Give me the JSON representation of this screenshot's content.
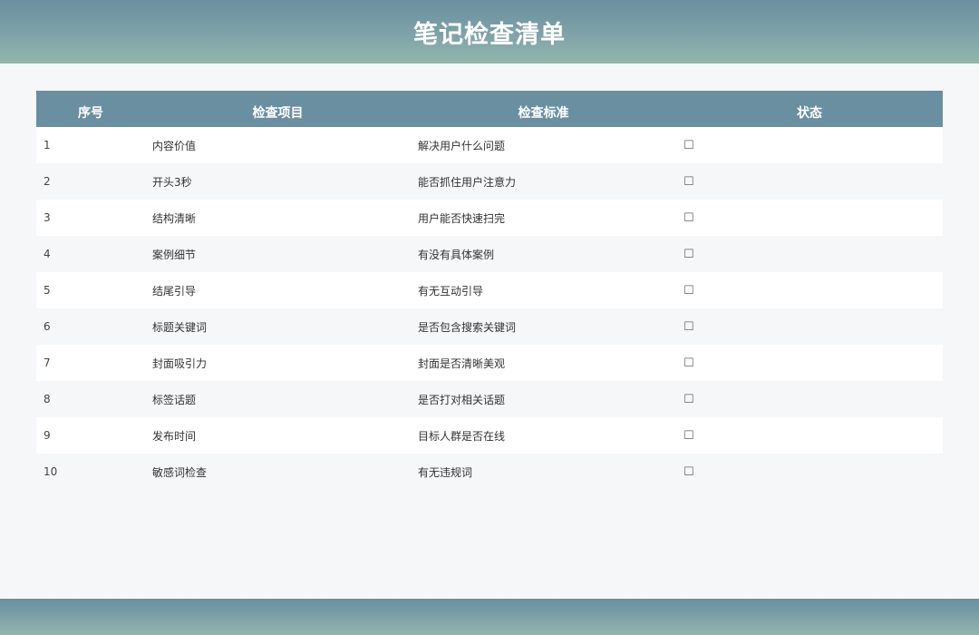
{
  "header": {
    "title": "笔记检查清单"
  },
  "colors": {
    "header_bar": "#6a8fa0",
    "header_gradient_end": "#93b7ad",
    "page_background": "#f5f7f9",
    "row_alt": "#f5f7f9",
    "row": "#ffffff"
  },
  "table": {
    "columns": [
      "序号",
      "检查项目",
      "检查标准",
      "状态"
    ],
    "rows": [
      {
        "index": "1",
        "item": "内容价值",
        "standard": "解决用户什么问题",
        "status": "☐"
      },
      {
        "index": "2",
        "item": "开头3秒",
        "standard": "能否抓住用户注意力",
        "status": "☐"
      },
      {
        "index": "3",
        "item": "结构清晰",
        "standard": "用户能否快速扫完",
        "status": "☐"
      },
      {
        "index": "4",
        "item": "案例细节",
        "standard": "有没有具体案例",
        "status": "☐"
      },
      {
        "index": "5",
        "item": "结尾引导",
        "standard": "有无互动引导",
        "status": "☐"
      },
      {
        "index": "6",
        "item": "标题关键词",
        "standard": "是否包含搜索关键词",
        "status": "☐"
      },
      {
        "index": "7",
        "item": "封面吸引力",
        "standard": "封面是否清晰美观",
        "status": "☐"
      },
      {
        "index": "8",
        "item": "标签话题",
        "standard": "是否打对相关话题",
        "status": "☐"
      },
      {
        "index": "9",
        "item": "发布时间",
        "standard": "目标人群是否在线",
        "status": "☐"
      },
      {
        "index": "10",
        "item": "敏感词检查",
        "standard": "有无违规词",
        "status": "☐"
      }
    ]
  }
}
